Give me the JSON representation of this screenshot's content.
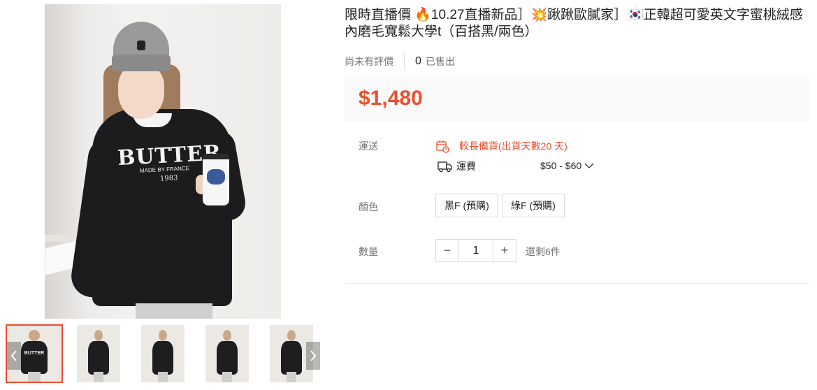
{
  "product": {
    "title": "限時直播價 🔥10.27直播新品］💥踿踿歐膩家］🇰🇷正韓超可愛英文字蜜桃絨感內磨毛寬鬆大學t（百搭黑/兩色）",
    "rating_text": "尚未有評價",
    "sold_count": "0",
    "sold_label": "已售出",
    "price": "$1,480"
  },
  "image_print": {
    "brand": "BUTTER",
    "sub": "MADE BY FRANCE",
    "year": "1983"
  },
  "gallery": {
    "thumb_count": 5,
    "active_index": 0,
    "prev_icon": "chevron-left-icon",
    "next_icon": "chevron-right-icon"
  },
  "shipping": {
    "label": "運送",
    "warning": "較長備貨(出貨天數20 天)",
    "fee_label": "運費",
    "fee_range": "$50 - $60"
  },
  "color": {
    "label": "顏色",
    "options": [
      "黑F (預購)",
      "綠F (預購)"
    ]
  },
  "quantity": {
    "label": "數量",
    "minus": "−",
    "value": "1",
    "plus": "+",
    "stock": "還剩6件"
  },
  "colors": {
    "accent": "#ee4d2d",
    "price_bg": "#fafafa"
  }
}
